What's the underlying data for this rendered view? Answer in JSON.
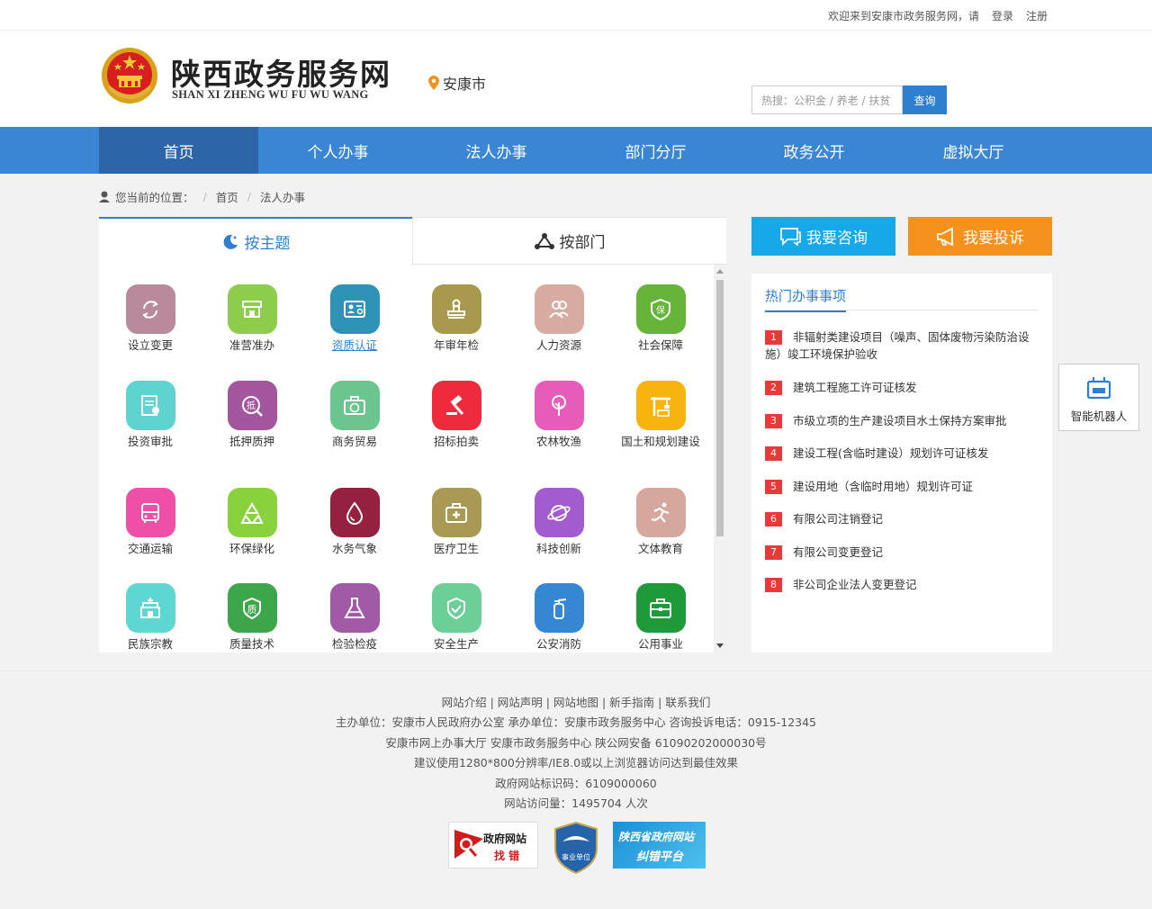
{
  "topbar": {
    "welcome": "欢迎来到安康市政务服务网，请",
    "login": "登录",
    "register": "注册"
  },
  "header": {
    "title": "陕西政务服务网",
    "subtitle": "SHAN XI ZHENG WU FU WU WANG",
    "city": "安康市",
    "search_placeholder": "热搜：公积金 / 养老 / 扶贫",
    "search_button": "查询"
  },
  "nav": [
    "首页",
    "个人办事",
    "法人办事",
    "部门分厅",
    "政务公开",
    "虚拟大厅"
  ],
  "breadcrumb": {
    "label": "您当前的位置：",
    "home": "首页",
    "current": "法人办事"
  },
  "tabs": {
    "theme": "按主题",
    "dept": "按部门"
  },
  "themes": [
    {
      "label": "设立变更",
      "color": "#b88a9c",
      "icon": "refresh-icon"
    },
    {
      "label": "准营准办",
      "color": "#8ccd4c",
      "icon": "store-icon"
    },
    {
      "label": "资质认证",
      "color": "#2f93b8",
      "icon": "certificate-icon"
    },
    {
      "label": "年审年检",
      "color": "#a79a4c",
      "icon": "stamp-icon"
    },
    {
      "label": "人力资源",
      "color": "#d7aaa2",
      "icon": "people-icon"
    },
    {
      "label": "社会保障",
      "color": "#67b43a",
      "icon": "shield-bao-icon"
    },
    {
      "label": "投资审批",
      "color": "#5dd4d0",
      "icon": "document-approve-icon"
    },
    {
      "label": "抵押质押",
      "color": "#a3569e",
      "icon": "mortgage-icon"
    },
    {
      "label": "商务贸易",
      "color": "#6ac58e",
      "icon": "briefcase-yen-icon"
    },
    {
      "label": "招标拍卖",
      "color": "#ef2a3d",
      "icon": "gavel-icon"
    },
    {
      "label": "农林牧渔",
      "color": "#e65cb8",
      "icon": "tree-icon"
    },
    {
      "label": "国土和规划建设",
      "color": "#f7b40c",
      "icon": "crane-icon"
    },
    {
      "label": "交通运输",
      "color": "#ef4fa6",
      "icon": "bus-icon"
    },
    {
      "label": "环保绿化",
      "color": "#8ad23d",
      "icon": "recycle-icon"
    },
    {
      "label": "水务气象",
      "color": "#96213e",
      "icon": "water-drop-icon"
    },
    {
      "label": "医疗卫生",
      "color": "#a89a54",
      "icon": "medical-kit-icon"
    },
    {
      "label": "科技创新",
      "color": "#a35bd0",
      "icon": "planet-icon"
    },
    {
      "label": "文体教育",
      "color": "#d6a79c",
      "icon": "runner-icon"
    },
    {
      "label": "民族宗教",
      "color": "#5ed7d2",
      "icon": "temple-icon"
    },
    {
      "label": "质量技术",
      "color": "#3ea64a",
      "icon": "quality-icon"
    },
    {
      "label": "检验检疫",
      "color": "#a05aa6",
      "icon": "flask-icon"
    },
    {
      "label": "安全生产",
      "color": "#6ccf97",
      "icon": "safety-shield-icon"
    },
    {
      "label": "公安消防",
      "color": "#3687d3",
      "icon": "extinguisher-icon"
    },
    {
      "label": "公用事业",
      "color": "#1f9a3a",
      "icon": "toolbox-icon"
    }
  ],
  "actions": {
    "consult": "我要咨询",
    "complain": "我要投诉"
  },
  "hot": {
    "title": "热门办事事项",
    "items": [
      {
        "num": "1",
        "text": "非辐射类建设项目（噪声、固体废物污染防治设施）竣工环境保护验收"
      },
      {
        "num": "2",
        "text": "建筑工程施工许可证核发"
      },
      {
        "num": "3",
        "text": "市级立项的生产建设项目水土保持方案审批"
      },
      {
        "num": "4",
        "text": "建设工程(含临时建设）规划许可证核发"
      },
      {
        "num": "5",
        "text": "建设用地（含临时用地）规划许可证"
      },
      {
        "num": "6",
        "text": "有限公司注销登记"
      },
      {
        "num": "7",
        "text": "有限公司变更登记"
      },
      {
        "num": "8",
        "text": "非公司企业法人变更登记"
      }
    ]
  },
  "robot": {
    "label": "智能机器人"
  },
  "footer": {
    "links": [
      "网站介绍",
      "网站声明",
      "网站地图",
      "新手指南",
      "联系我们"
    ],
    "line2": "主办单位：安康市人民政府办公室   承办单位：安康市政务服务中心   咨询投诉电话：0915-12345",
    "line3": "安康市网上办事大厅   安康市政务服务中心   陕公网安备 61090202000030号",
    "line4": "建议使用1280*800分辨率/IE8.0或以上浏览器访问达到最佳效果",
    "line5": "政府网站标识码：6109000060",
    "line6": "网站访问量：1495704 人次",
    "badge1_line1": "政府网站",
    "badge1_line2": "找 错",
    "badge2_text": "事业单位",
    "badge3_line1": "陕西省政府网站",
    "badge3_line2": "纠错平台"
  }
}
